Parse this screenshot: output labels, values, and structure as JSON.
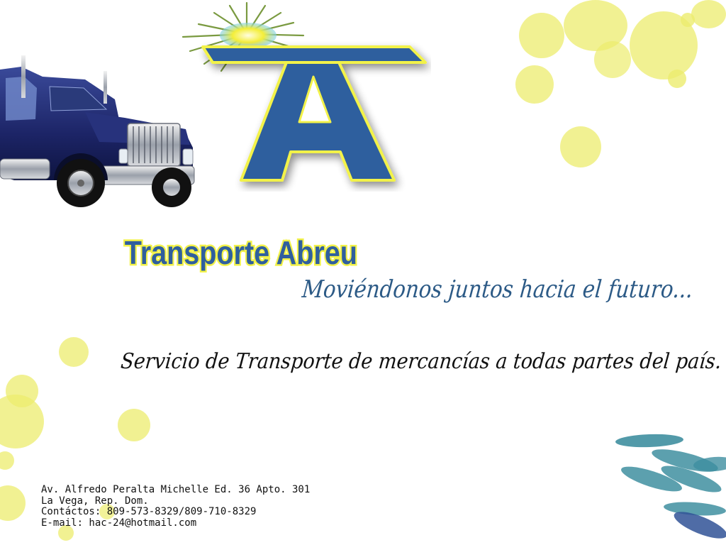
{
  "company": {
    "name": "Transporte Abreu",
    "slogan": "Moviéndonos juntos hacia el futuro...",
    "service": "Servicio de Transporte de mercancías a todas partes del país."
  },
  "contact": {
    "address": "Av. Alfredo Peralta Michelle Ed. 36 Apto. 301",
    "city": "La Vega, Rep. Dom.",
    "phones": "Contáctos: 809-573-8329/809-710-8329",
    "email": "E-mail: hac-24@hotmail.com"
  },
  "logo": {
    "letter": "A",
    "icon": "sun-icon"
  },
  "colors": {
    "brand_blue": "#2f5f9e",
    "logo_yellow": "#f2f24a",
    "slogan_blue": "#2c5a86",
    "service_text": "#111111",
    "dots": "#ecec7a",
    "swooshes": "#3f8fa0"
  }
}
